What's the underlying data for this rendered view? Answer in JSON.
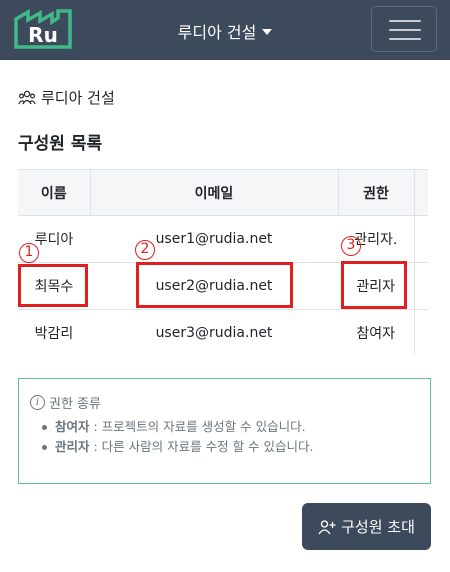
{
  "navbar": {
    "logo_text": "Ru",
    "company": "루디아 건설",
    "menu_icon": "hamburger-icon"
  },
  "crumb": {
    "icon": "people-icon",
    "label": "루디아 건설"
  },
  "section_title": "구성원 목록",
  "table": {
    "headers": {
      "name": "이름",
      "email": "이메일",
      "role": "권한"
    },
    "rows": [
      {
        "name": "루디아",
        "email": "user1@rudia.net",
        "role": "관리자."
      },
      {
        "name": "최목수",
        "email": "user2@rudia.net",
        "role": "관리자"
      },
      {
        "name": "박감리",
        "email": "user3@rudia.net",
        "role": "참여자"
      }
    ]
  },
  "annotations": [
    "1",
    "2",
    "3"
  ],
  "info": {
    "icon": "info-icon",
    "title": "권한 종류",
    "items": [
      {
        "term": "참여자",
        "desc": " : 프로젝트의 자료를 생성할 수 있습니다."
      },
      {
        "term": "관리자",
        "desc": " : 다른 사람의 자료를 수정 할 수 있습니다."
      }
    ]
  },
  "invite_button": {
    "icon": "person-plus-icon",
    "label": "구성원 초대"
  },
  "colors": {
    "navbar": "#3d4a5c",
    "logo_green": "#3fb98a",
    "annotation_red": "#e02020",
    "info_border": "#66bb99"
  }
}
